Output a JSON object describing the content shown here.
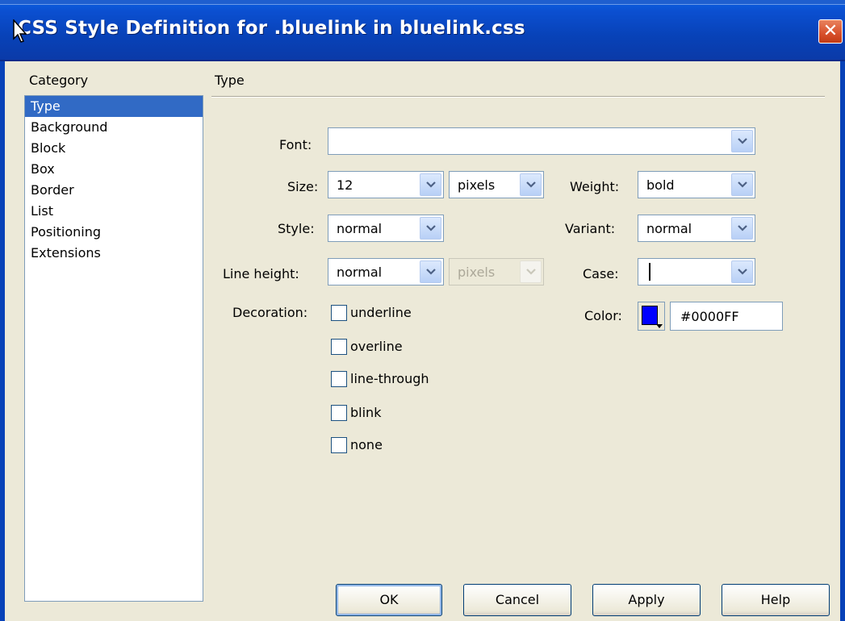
{
  "window": {
    "title": "CSS Style Definition for .bluelink in bluelink.css",
    "close_glyph": "✕"
  },
  "category": {
    "label": "Category",
    "items": [
      "Type",
      "Background",
      "Block",
      "Box",
      "Border",
      "List",
      "Positioning",
      "Extensions"
    ],
    "selected": "Type"
  },
  "panel": {
    "title": "Type",
    "font": {
      "label": "Font:",
      "value": ""
    },
    "size": {
      "label": "Size:",
      "value": "12",
      "unit": "pixels"
    },
    "weight": {
      "label": "Weight:",
      "value": "bold"
    },
    "style": {
      "label": "Style:",
      "value": "normal"
    },
    "variant": {
      "label": "Variant:",
      "value": "normal"
    },
    "line_height": {
      "label": "Line height:",
      "value": "normal",
      "unit": "pixels"
    },
    "case": {
      "label": "Case:",
      "value": ""
    },
    "decoration": {
      "label": "Decoration:",
      "options": [
        "underline",
        "overline",
        "line-through",
        "blink",
        "none"
      ]
    },
    "color": {
      "label": "Color:",
      "value": "#0000FF",
      "swatch": "#0000ff"
    }
  },
  "buttons": {
    "ok": "OK",
    "cancel": "Cancel",
    "apply": "Apply",
    "help": "Help"
  },
  "icons": {
    "dropdown": "chevron-down-icon",
    "close": "close-icon",
    "cursor": "mouse-pointer-icon"
  },
  "colors": {
    "titlebar": "#0842b8",
    "selection": "#316ac5",
    "dialog_bg": "#ece9d8",
    "close": "#d8502b"
  }
}
